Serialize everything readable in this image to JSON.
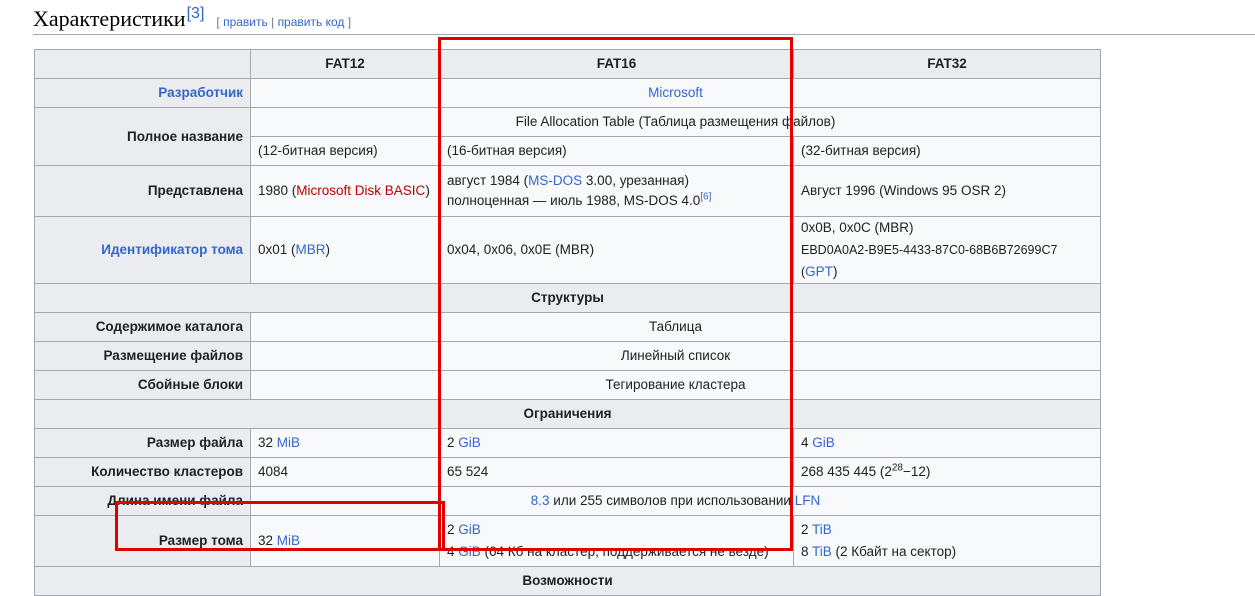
{
  "heading": {
    "title": "Характеристики",
    "ref": "[3]",
    "edit_bracket_open": "[",
    "edit": "править",
    "sep": "|",
    "edit_code": "править код",
    "edit_bracket_close": "]"
  },
  "table": {
    "columns": [
      "FAT12",
      "FAT16",
      "FAT32"
    ],
    "developer": {
      "label": "Разработчик",
      "value": "Microsoft"
    },
    "full_name": {
      "label": "Полное название",
      "span": "File Allocation Table (Таблица размещения файлов)",
      "fat12": "(12-битная версия)",
      "fat16": "(16-битная версия)",
      "fat32": "(32-битная версия)"
    },
    "introduced": {
      "label": "Представлена",
      "fat12_year": "1980 (",
      "fat12_link": "Microsoft Disk BASIC",
      "fat12_close": ")",
      "fat16_a": "август 1984 (",
      "fat16_link": "MS-DOS",
      "fat16_b": " 3.00, урезанная)",
      "fat16_c": "полноценная — июль 1988, MS-DOS 4.0",
      "fat16_ref": "[6]",
      "fat32": "Август 1996 (Windows 95 OSR 2)"
    },
    "volume_id": {
      "label": "Идентификатор тома",
      "fat12_a": "0x01 (",
      "fat12_link": "MBR",
      "fat12_b": ")",
      "fat16": "0x04, 0x06, 0x0E (MBR)",
      "fat32_a": "0x0B, 0x0C (MBR)",
      "fat32_b": "EBD0A0A2-B9E5-4433-87C0-68B6B72699C7 (",
      "fat32_link": "GPT",
      "fat32_c": ")"
    },
    "structures": {
      "section": "Структуры",
      "dir_label": "Содержимое каталога",
      "dir_value": "Таблица",
      "alloc_label": "Размещение файлов",
      "alloc_value": "Линейный список",
      "bad_label": "Сбойные блоки",
      "bad_value": "Тегирование кластера"
    },
    "limits": {
      "section": "Ограничения",
      "file_size_label": "Размер файла",
      "fat12_num": "32 ",
      "fat12_unit": "MiB",
      "fat16_num": "2 ",
      "fat16_unit": "GiB",
      "fat32_num": "4 ",
      "fat32_unit": "GiB",
      "clusters_label": "Количество кластеров",
      "clusters_fat12": "4084",
      "clusters_fat16": "65 524",
      "clusters_fat32_a": "268 435 445 (2",
      "clusters_fat32_sup": "28",
      "clusters_fat32_b": "−12)",
      "name_label": "Длина имени файла",
      "name_link1": "8.3",
      "name_text": " или 255 символов при использовании ",
      "name_link2": "LFN",
      "volume_label": "Размер тома",
      "vol_fat12_num": "32 ",
      "vol_fat12_unit": "MiB",
      "vol_fat16_a_num": "2 ",
      "vol_fat16_a_unit": "GiB",
      "vol_fat16_b_num": "4 ",
      "vol_fat16_b_unit": "GiB",
      "vol_fat16_b_text": " (64 Кб на кластер, поддерживается не везде)",
      "vol_fat32_a_num": "2 ",
      "vol_fat32_a_unit": "TiB",
      "vol_fat32_b_num": "8 ",
      "vol_fat32_b_unit": "TiB",
      "vol_fat32_b_text": " (2 Кбайт на сектор)"
    },
    "features": {
      "section": "Возможности"
    }
  },
  "colors": {
    "link": "#3366cc",
    "redlink": "#ba0000",
    "highlight": "#e00000",
    "header_bg": "#eaecf0",
    "cell_bg": "#f8f9fa"
  }
}
